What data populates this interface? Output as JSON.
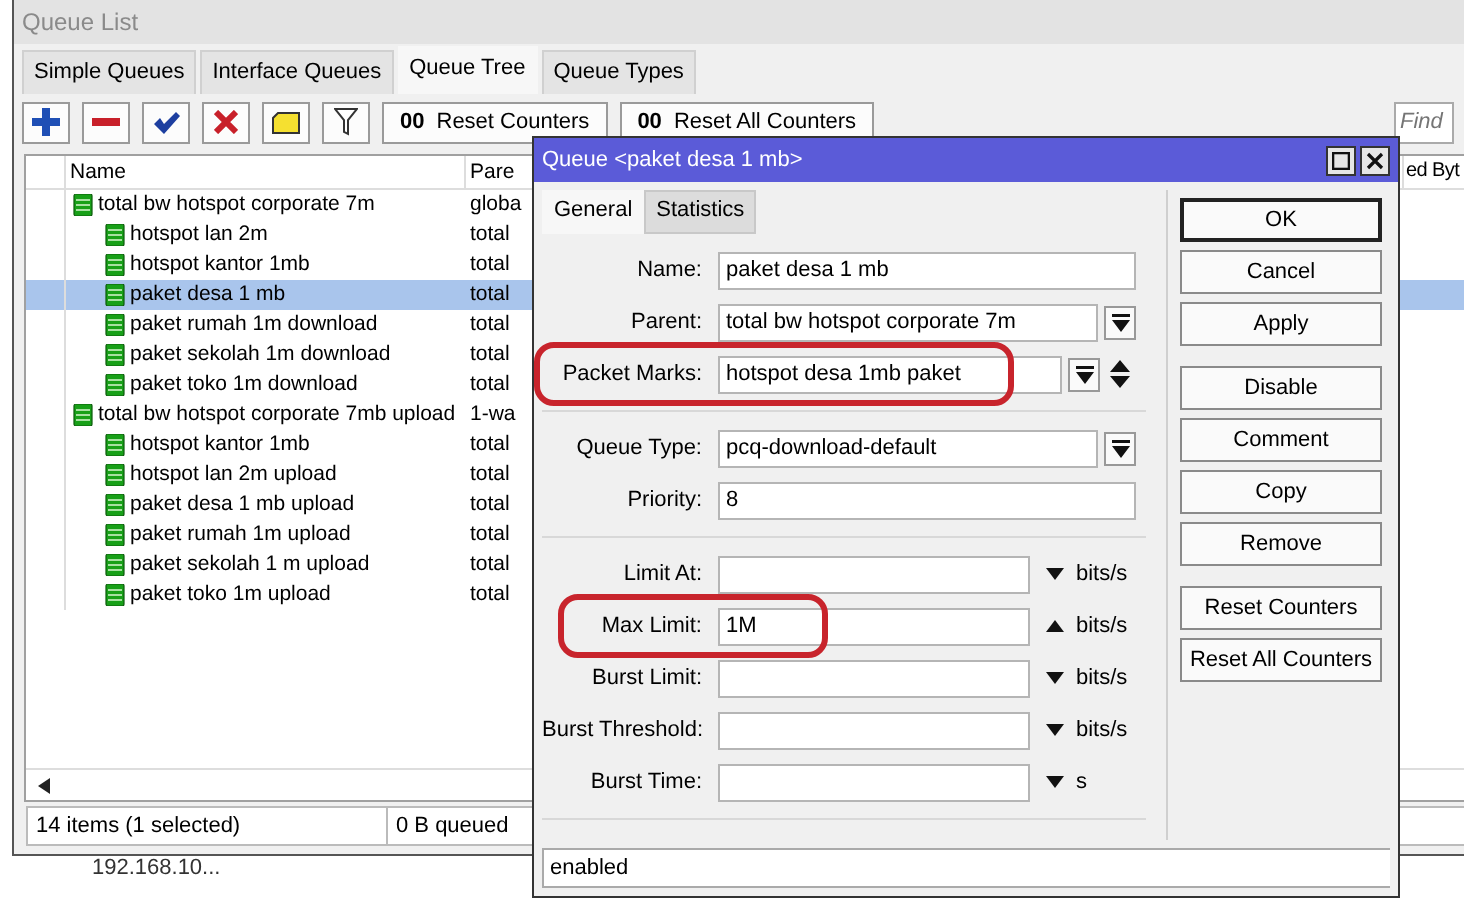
{
  "list_window": {
    "title": "Queue List",
    "tabs": [
      {
        "label": "Simple Queues",
        "selected": false
      },
      {
        "label": "Interface Queues",
        "selected": false
      },
      {
        "label": "Queue Tree",
        "selected": true
      },
      {
        "label": "Queue Types",
        "selected": false
      }
    ],
    "toolbar": {
      "icons": [
        {
          "kind": "add"
        },
        {
          "kind": "remove"
        },
        {
          "kind": "enable"
        },
        {
          "kind": "disable"
        },
        {
          "kind": "comment"
        },
        {
          "kind": "filter"
        }
      ],
      "buttons": [
        {
          "glyph": "00",
          "label": "Reset Counters"
        },
        {
          "glyph": "00",
          "label": "Reset All Counters"
        }
      ],
      "search": {
        "placeholder": "Find"
      }
    },
    "table": {
      "columns": [
        "Name",
        "Pare",
        "ed Byt"
      ],
      "rows": [
        {
          "name": "total bw hotspot corporate 7m",
          "parent": "globa",
          "selected": false,
          "children": [
            {
              "name": "hotspot lan 2m",
              "parent": "total",
              "selected": false
            },
            {
              "name": "hotspot kantor 1mb",
              "parent": "total",
              "selected": false
            },
            {
              "name": "paket desa 1 mb",
              "parent": "total",
              "selected": true
            },
            {
              "name": "paket rumah 1m download",
              "parent": "total",
              "selected": false
            },
            {
              "name": "paket sekolah 1m download",
              "parent": "total",
              "selected": false
            },
            {
              "name": "paket toko 1m download",
              "parent": "total",
              "selected": false
            }
          ]
        },
        {
          "name": "total bw hotspot corporate 7mb upload",
          "parent": "1-wa",
          "selected": false,
          "children": [
            {
              "name": "hotspot kantor 1mb",
              "parent": "total",
              "selected": false
            },
            {
              "name": "hotspot lan 2m upload",
              "parent": "total",
              "selected": false
            },
            {
              "name": "paket desa 1 mb upload",
              "parent": "total",
              "selected": false
            },
            {
              "name": "paket rumah 1m upload",
              "parent": "total",
              "selected": false
            },
            {
              "name": "paket sekolah 1 m upload",
              "parent": "total",
              "selected": false
            },
            {
              "name": "paket toko 1m upload",
              "parent": "total",
              "selected": false
            }
          ]
        }
      ]
    },
    "status_bar": [
      "14 items (1 selected)",
      "0 B queued"
    ]
  },
  "behind_text": "192.168.10...",
  "dialog": {
    "title": "Queue <paket desa 1 mb>",
    "tabs": [
      {
        "label": "General",
        "selected": true
      },
      {
        "label": "Statistics",
        "selected": false
      }
    ],
    "groups": [
      [
        {
          "kind": "text",
          "label": "Name:",
          "value": "paket desa 1 mb",
          "highlighted": false
        },
        {
          "kind": "select",
          "label": "Parent:",
          "value": "total bw hotspot corporate 7m",
          "highlighted": false
        },
        {
          "kind": "marks",
          "label": "Packet Marks:",
          "value": "hotspot desa 1mb paket",
          "highlighted": true
        }
      ],
      [
        {
          "kind": "select",
          "label": "Queue Type:",
          "value": "pcq-download-default",
          "highlighted": false
        },
        {
          "kind": "text",
          "label": "Priority:",
          "value": "8",
          "highlighted": false
        }
      ],
      [
        {
          "kind": "limit",
          "label": "Limit At:",
          "unit": "bits/s",
          "expanded": false,
          "highlighted": false
        },
        {
          "kind": "limit",
          "label": "Max Limit:",
          "value": "1M",
          "unit": "bits/s",
          "expanded": true,
          "highlighted": true
        },
        {
          "kind": "limit",
          "label": "Burst Limit:",
          "unit": "bits/s",
          "expanded": false,
          "highlighted": false
        },
        {
          "kind": "limit",
          "label": "Burst Threshold:",
          "unit": "bits/s",
          "expanded": false,
          "highlighted": false
        },
        {
          "kind": "limit",
          "label": "Burst Time:",
          "unit": "s",
          "expanded": false,
          "highlighted": false
        }
      ]
    ],
    "button_groups": [
      [
        {
          "label": "OK",
          "default": true
        },
        {
          "label": "Cancel",
          "default": false
        },
        {
          "label": "Apply",
          "default": false
        }
      ],
      [
        {
          "label": "Disable",
          "default": false
        },
        {
          "label": "Comment",
          "default": false
        },
        {
          "label": "Copy",
          "default": false
        },
        {
          "label": "Remove",
          "default": false
        }
      ],
      [
        {
          "label": "Reset Counters",
          "default": false
        },
        {
          "label": "Reset All Counters",
          "default": false
        }
      ]
    ],
    "status": "enabled"
  }
}
